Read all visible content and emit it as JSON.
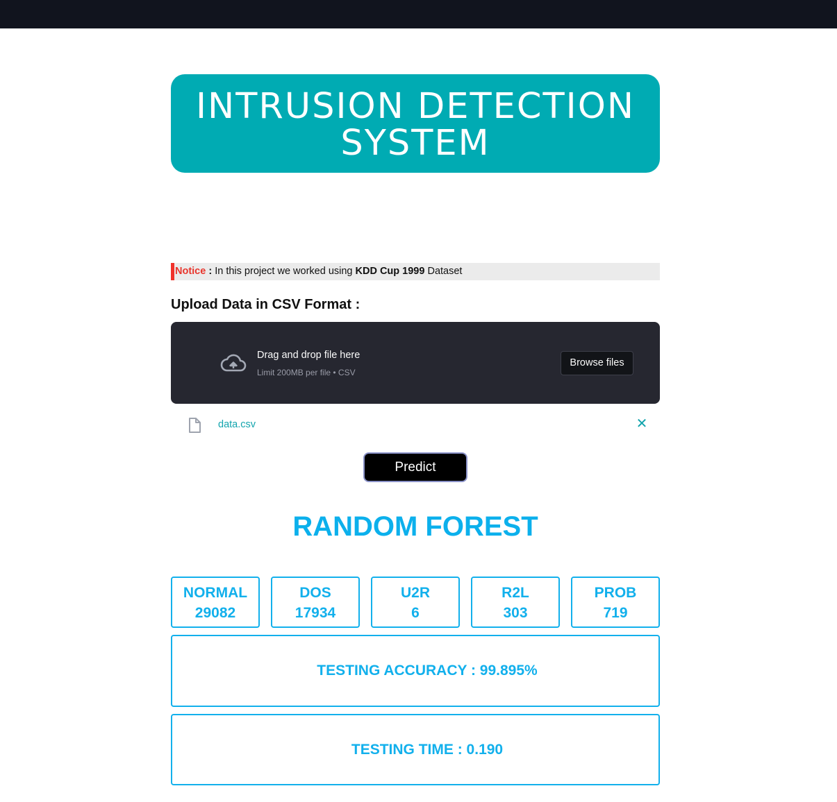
{
  "header": {
    "title": "INTRUSION DETECTION SYSTEM"
  },
  "notice": {
    "label": "Notice",
    "separator": " : ",
    "text_before": "In this project we worked using ",
    "dataset": "KDD Cup 1999",
    "text_after": " Dataset"
  },
  "upload": {
    "heading": "Upload Data in CSV Format :",
    "drag_text": "Drag and drop file here",
    "limit_text": "Limit 200MB per file • CSV",
    "browse_label": "Browse files",
    "file_name": "data.csv",
    "remove_glyph": "✕"
  },
  "predict_label": "Predict",
  "results": {
    "model_name": "RANDOM FOREST",
    "classes": [
      {
        "label": "NORMAL",
        "count": "29082"
      },
      {
        "label": "DOS",
        "count": "17934"
      },
      {
        "label": "U2R",
        "count": "6"
      },
      {
        "label": "R2L",
        "count": "303"
      },
      {
        "label": "PROB",
        "count": "719"
      }
    ],
    "accuracy_text": "TESTING ACCURACY : 99.895%",
    "time_text": "TESTING TIME : 0.190"
  },
  "colors": {
    "title_bg": "#00abb3",
    "accent": "#12b0ec",
    "notice_red": "#e8352c",
    "dropzone_bg": "#262730",
    "topbar_bg": "#11141e"
  },
  "icons": {
    "upload": "cloud-upload-icon",
    "file": "file-icon",
    "remove": "close-icon"
  }
}
